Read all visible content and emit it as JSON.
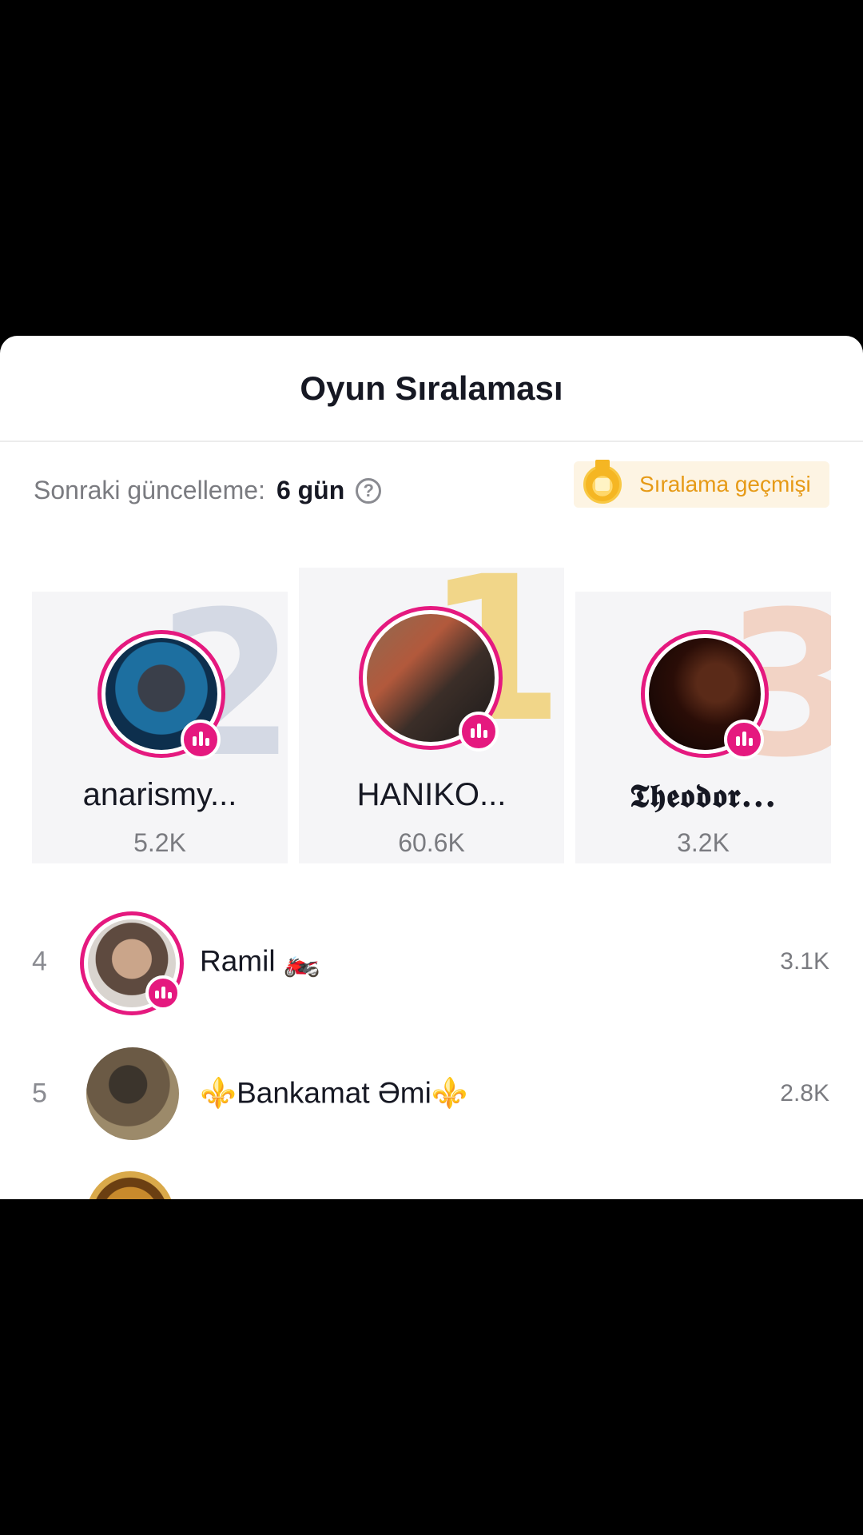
{
  "header": {
    "title": "Oyun Sıralaması"
  },
  "subbar": {
    "next_update_label": "Sonraki güncelleme:",
    "next_update_value": "6 gün",
    "history_button": "Sıralama geçmişi"
  },
  "podium": [
    {
      "rank": "2",
      "name": "anarismy...",
      "score": "5.2K",
      "live": true
    },
    {
      "rank": "1",
      "name": "HANIKO...",
      "score": "60.6K",
      "live": true
    },
    {
      "rank": "3",
      "name": "𝕿𝖍𝖊𝖔𝖉𝖔𝖗...",
      "score": "3.2K",
      "live": true
    }
  ],
  "list": [
    {
      "rank": "4",
      "name": "Ramil 🏍️",
      "score": "3.1K",
      "live": true
    },
    {
      "rank": "5",
      "name": "⚜️Bankamat Əmi⚜️",
      "score": "2.8K",
      "live": false
    }
  ],
  "colors": {
    "live_accent": "#e5197f",
    "history_text": "#e69a16",
    "history_bg": "#fdf4e3",
    "gold": "#f1d689",
    "silver": "#d4d9e4",
    "bronze": "#f2d3c5"
  },
  "icons": {
    "help": "question-circle-icon",
    "history": "medal-icon",
    "live": "live-audio-icon"
  }
}
